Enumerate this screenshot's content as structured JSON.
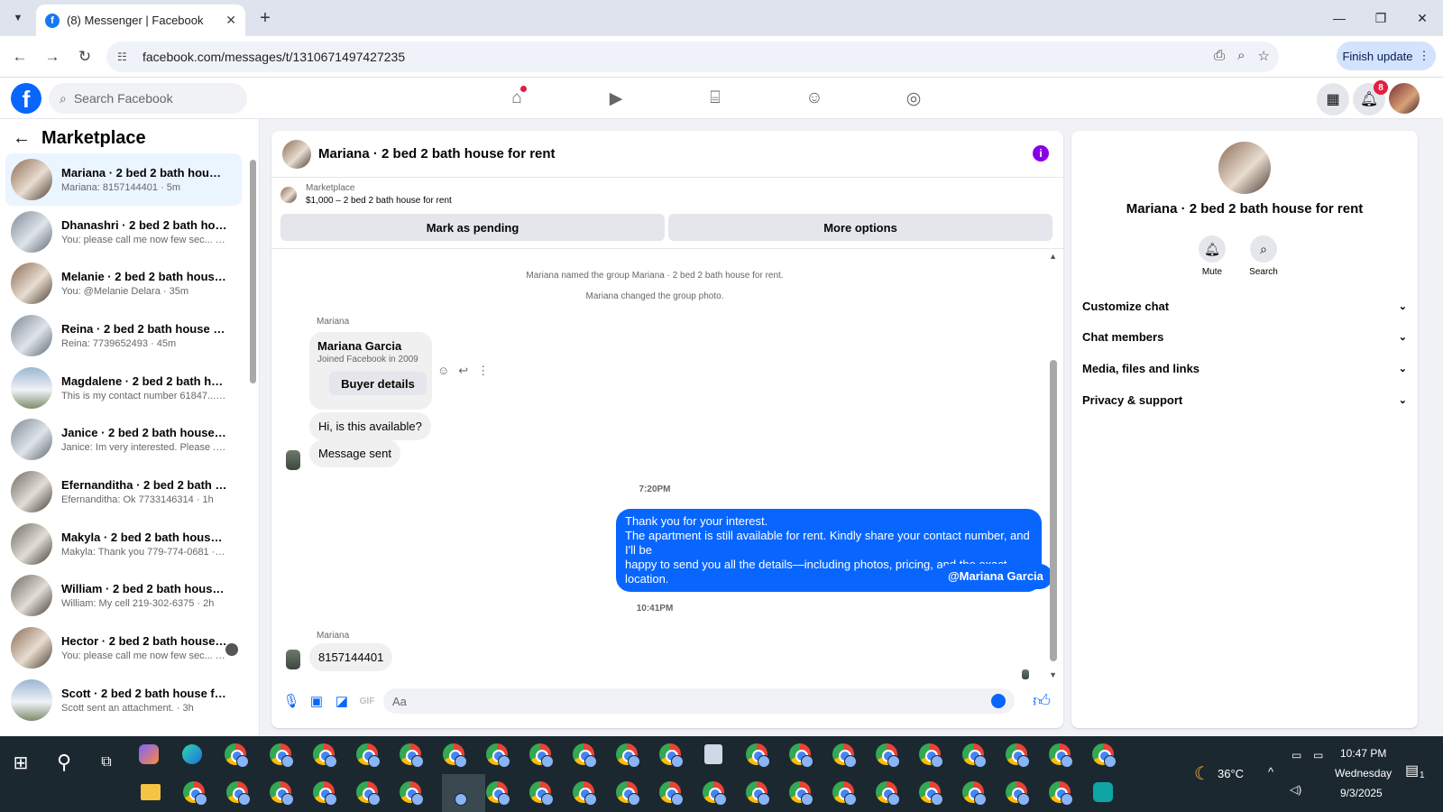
{
  "browser": {
    "tab_title": "(8) Messenger | Facebook",
    "url": "facebook.com/messages/t/1310671497427235",
    "finish_update": "Finish update"
  },
  "fb": {
    "search_placeholder": "Search Facebook",
    "notif_count": "8"
  },
  "sidebar": {
    "title": "Marketplace",
    "conversations": [
      {
        "name": "Mariana · 2 bed 2 bath house fo...",
        "preview": "Mariana: 8157144401 · 5m",
        "active": true
      },
      {
        "name": "Dhanashri · 2 bed 2 bath house ...",
        "preview": "You: please call me now few sec... · 35m"
      },
      {
        "name": "Melanie · 2 bed 2 bath house fo...",
        "preview": "You: @Melanie Delara · 35m"
      },
      {
        "name": "Reina · 2 bed 2 bath house for r...",
        "preview": "Reina: 7739652493 · 45m"
      },
      {
        "name": "Magdalene · 2 bed 2 bath hous...",
        "preview": "This is my contact number 61847... · 54m"
      },
      {
        "name": "Janice · 2 bed 2 bath house for ...",
        "preview": "Janice: Im very interested. Please ... · 1h"
      },
      {
        "name": "Efernanditha · 2 bed 2 bath hou...",
        "preview": "Efernanditha: Ok 7733146314 · 1h"
      },
      {
        "name": "Makyla · 2 bed 2 bath house for...",
        "preview": "Makyla: Thank you 779-774-0681 · 2h"
      },
      {
        "name": "William · 2 bed 2 bath house fo...",
        "preview": "William: My cell 219-302-6375 · 2h"
      },
      {
        "name": "Hector · 2 bed 2 bath house f...",
        "preview": "You: please call me now few sec... · 2h"
      },
      {
        "name": "Scott · 2 bed 2 bath house for r...",
        "preview": "Scott sent an attachment. · 3h"
      }
    ]
  },
  "chat": {
    "title": "Mariana · 2 bed 2 bath house for rent",
    "marketplace_label": "Marketplace",
    "listing": "$1,000 – 2 bed 2 bath house for rent",
    "mark_pending": "Mark as pending",
    "more_options": "More options",
    "sys1": "Mariana named the group Mariana · 2 bed 2 bath house for rent.",
    "sys2": "Mariana changed the group photo.",
    "sender": "Mariana",
    "card_name": "Mariana Garcia",
    "card_sub": "Joined Facebook in 2009",
    "card_button": "Buyer details",
    "msg_available": "Hi, is this available?",
    "msg_sent": "Message sent",
    "time1": "7:20PM",
    "out_line1": "Thank you for your interest.",
    "out_line2": "The apartment is still available for rent. Kindly share your contact number, and I'll be",
    "out_line3": "happy to send you all the details—including photos, pricing, and the exact location.",
    "mention": "@Mariana Garcia",
    "time2": "10:41PM",
    "sender2": "Mariana",
    "msg_number": "8157144401",
    "composer_placeholder": "Aa"
  },
  "info_panel": {
    "name": "Mariana · 2 bed 2 bath house for rent",
    "mute": "Mute",
    "search": "Search",
    "sections": [
      "Customize chat",
      "Chat members",
      "Media, files and links",
      "Privacy & support"
    ]
  },
  "taskbar": {
    "weather": "36°C",
    "time": "10:47 PM",
    "day": "Wednesday",
    "date": "9/3/2025",
    "notif": "1"
  },
  "colors": {
    "accent": "#0866ff",
    "info_purple": "#8a00e6",
    "badge_red": "#e41e3f"
  }
}
